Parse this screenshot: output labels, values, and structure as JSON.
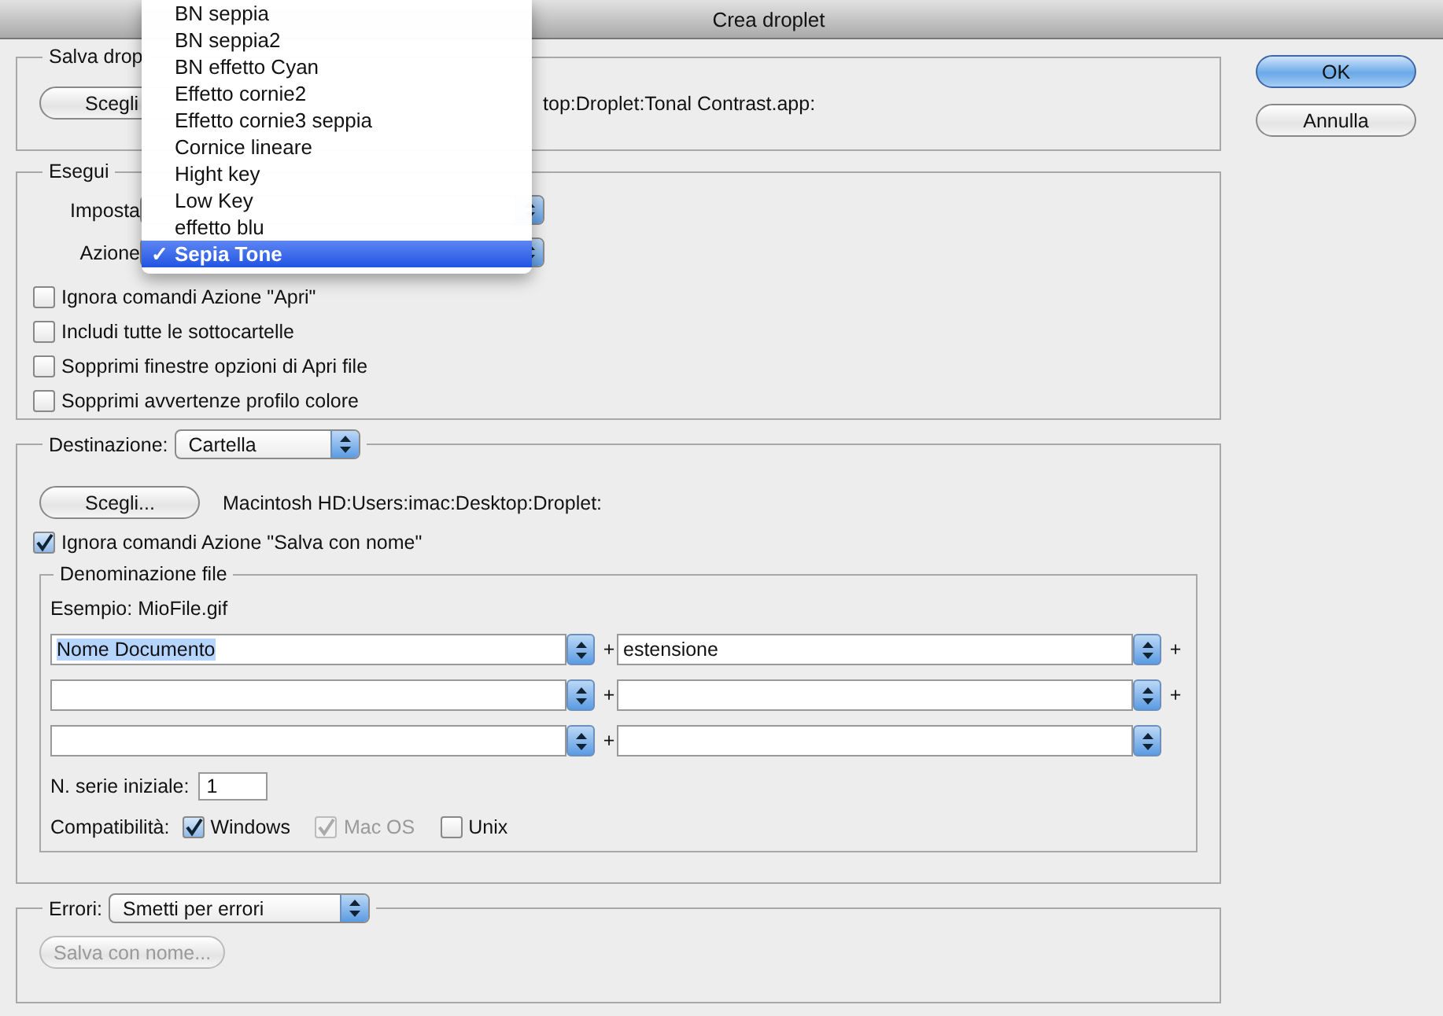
{
  "window": {
    "title": "Crea droplet"
  },
  "menu": {
    "check": "✓",
    "items": [
      {
        "label": "BN seppia",
        "selected": false
      },
      {
        "label": "BN seppia2",
        "selected": false
      },
      {
        "label": "BN effetto Cyan",
        "selected": false
      },
      {
        "label": "Effetto cornie2",
        "selected": false
      },
      {
        "label": "Effetto cornie3 seppia",
        "selected": false
      },
      {
        "label": "Cornice lineare",
        "selected": false
      },
      {
        "label": "Hight key",
        "selected": false
      },
      {
        "label": "Low Key",
        "selected": false
      },
      {
        "label": "effetto blu",
        "selected": false
      },
      {
        "label": "Sepia Tone",
        "selected": true
      }
    ]
  },
  "save_section": {
    "legend": "Salva drop",
    "button": "Scegli",
    "path": "top:Droplet:Tonal Contrast.app:"
  },
  "run_section": {
    "legend": "Esegui",
    "set_label": "Imposta",
    "action_label": "Azione",
    "options": [
      {
        "label": "Ignora comandi Azione \"Apri\"",
        "checked": false
      },
      {
        "label": "Includi tutte le sottocartelle",
        "checked": false
      },
      {
        "label": "Sopprimi finestre opzioni di Apri file",
        "checked": false
      },
      {
        "label": "Sopprimi avvertenze profilo colore",
        "checked": false
      }
    ]
  },
  "destination": {
    "label": "Destinazione:",
    "popup": "Cartella",
    "button": "Scegli...",
    "path": "Macintosh HD:Users:imac:Desktop:Droplet:",
    "override": {
      "label": "Ignora comandi Azione \"Salva con nome\"",
      "checked": true
    },
    "naming": {
      "legend": "Denominazione file",
      "example": "Esempio: MioFile.gif",
      "rows": [
        {
          "left": "Nome Documento",
          "highlighted": true,
          "join": "+",
          "right": "estensione",
          "tail": "+"
        },
        {
          "left": "",
          "join": "+",
          "right": "",
          "tail": "+"
        },
        {
          "left": "",
          "join": "+",
          "right": ""
        }
      ],
      "serial_label": "N. serie iniziale:",
      "serial_value": "1",
      "compat_label": "Compatibilità:",
      "compat": [
        {
          "label": "Windows",
          "checked": true,
          "disabled": false
        },
        {
          "label": "Mac OS",
          "checked": true,
          "disabled": true
        },
        {
          "label": "Unix",
          "checked": false,
          "disabled": false
        }
      ]
    }
  },
  "errors": {
    "label": "Errori:",
    "popup": "Smetti per errori",
    "button": {
      "label": "Salva con nome...",
      "disabled": true
    }
  },
  "buttons": [
    {
      "label": "OK",
      "default": true
    },
    {
      "label": "Annulla",
      "default": false
    }
  ]
}
